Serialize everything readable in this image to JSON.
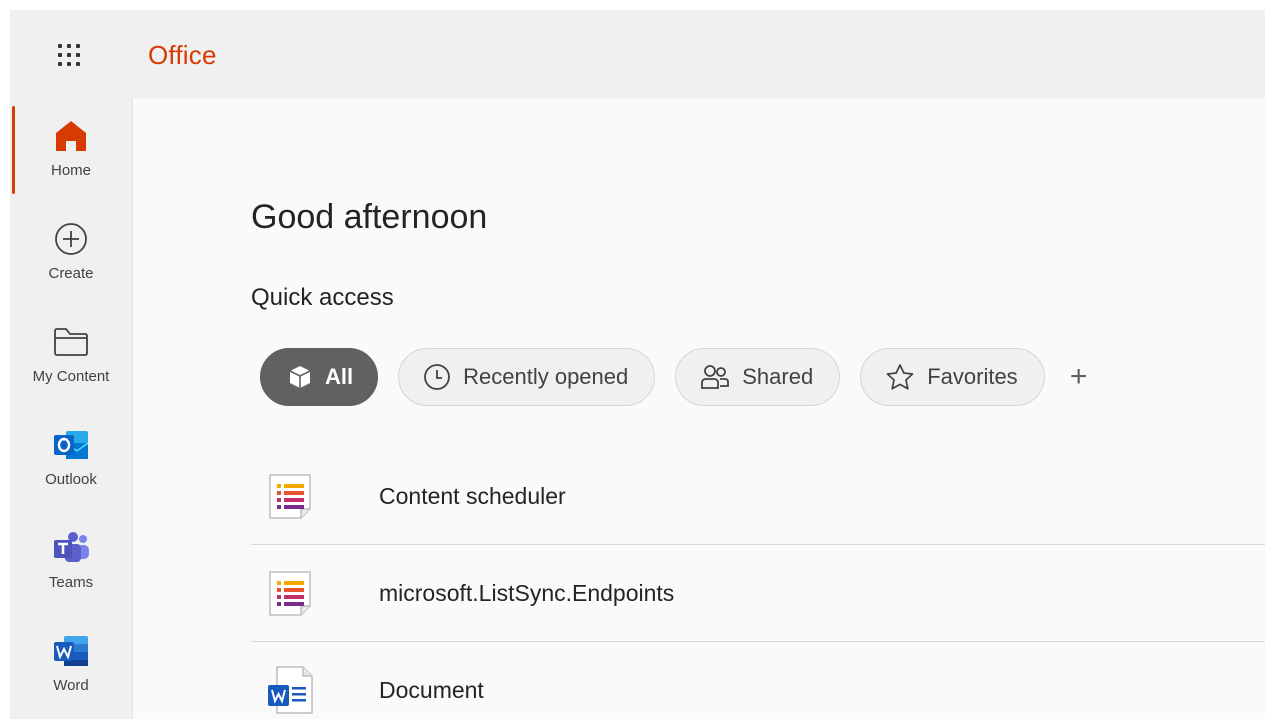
{
  "app": {
    "brand": "Office"
  },
  "sidebar": {
    "items": [
      {
        "label": "Home",
        "icon": "home-icon",
        "active": true
      },
      {
        "label": "Create",
        "icon": "plus-circle-icon"
      },
      {
        "label": "My Content",
        "icon": "folder-icon"
      },
      {
        "label": "Outlook",
        "icon": "outlook-icon"
      },
      {
        "label": "Teams",
        "icon": "teams-icon"
      },
      {
        "label": "Word",
        "icon": "word-icon"
      }
    ]
  },
  "main": {
    "greeting": "Good afternoon",
    "section_title": "Quick access",
    "filters": [
      {
        "label": "All",
        "icon": "cube-icon",
        "selected": true
      },
      {
        "label": "Recently opened",
        "icon": "clock-icon"
      },
      {
        "label": "Shared",
        "icon": "people-icon"
      },
      {
        "label": "Favorites",
        "icon": "star-icon"
      }
    ],
    "add_filter_label": "+",
    "files": [
      {
        "name": "Content scheduler",
        "icon": "lists-file-icon"
      },
      {
        "name": "microsoft.ListSync.Endpoints",
        "icon": "lists-file-icon"
      },
      {
        "name": "Document",
        "icon": "word-file-icon"
      }
    ]
  },
  "colors": {
    "accent": "#d83b01",
    "chip_selected": "#616161",
    "outlook_blue": "#0a64c8",
    "teams_purple": "#5b5fc7",
    "word_blue": "#185abd"
  }
}
